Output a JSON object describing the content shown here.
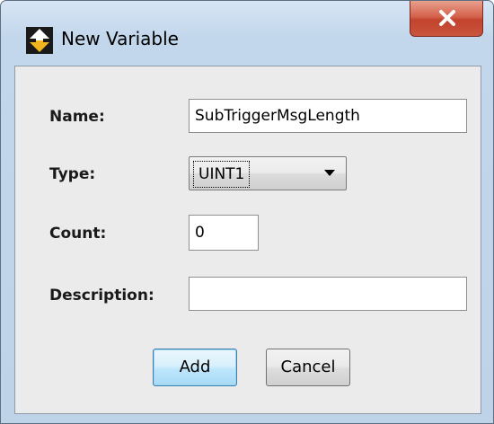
{
  "window": {
    "title": "New Variable"
  },
  "form": {
    "name_label": "Name:",
    "name_value": "SubTriggerMsgLength",
    "type_label": "Type:",
    "type_value": "UINT1",
    "count_label": "Count:",
    "count_value": "0",
    "description_label": "Description:",
    "description_value": ""
  },
  "buttons": {
    "add_label": "Add",
    "cancel_label": "Cancel"
  },
  "icons": {
    "app": "up-down-arrow-app-icon",
    "close": "close-icon",
    "dropdown": "chevron-down-icon"
  },
  "colors": {
    "app_icon_accent": "#f2b51d",
    "close_button": "#c9553e",
    "default_button_border": "#3c7fb1"
  }
}
